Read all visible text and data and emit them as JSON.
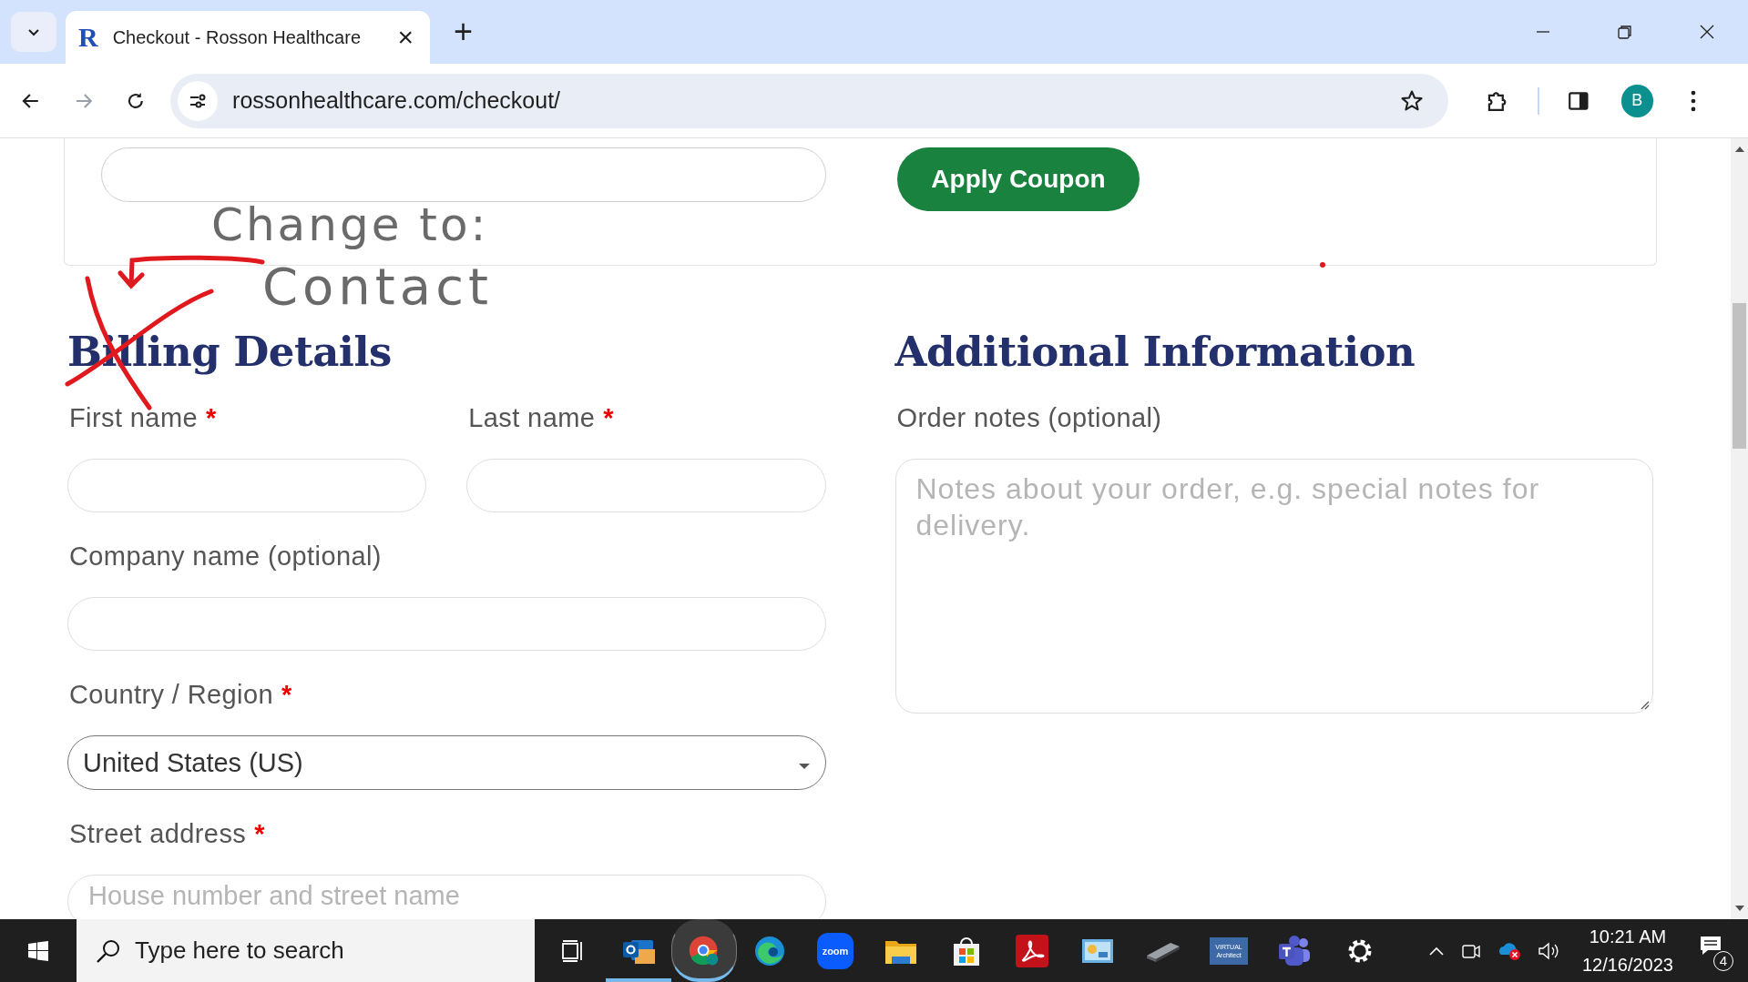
{
  "browser": {
    "favicon": "R",
    "tab_title": "Checkout - Rosson Healthcare",
    "close": "×",
    "new_tab": "+",
    "address": "rossonhealthcare.com/checkout/",
    "profile": "B"
  },
  "coupon": {
    "button": "Apply Coupon"
  },
  "annotation": {
    "lines": [
      "Change to:",
      "Contact"
    ]
  },
  "billing": {
    "heading": "Billing Details",
    "rows": [
      [
        {
          "label": "First name",
          "marker": "*",
          "kind": "input"
        },
        {
          "label": "Last name",
          "marker": "*",
          "kind": "input"
        }
      ],
      [
        {
          "label": "Company name (optional)",
          "kind": "input"
        }
      ],
      [
        {
          "label": "Country / Region",
          "marker": "*",
          "kind": "select",
          "value": "United States (US)"
        }
      ],
      [
        {
          "label": "Street address",
          "marker": "*",
          "kind": "input",
          "placeholder": "House number and street name"
        }
      ]
    ]
  },
  "additional": {
    "heading": "Additional Information",
    "label": "Order notes (optional)",
    "placeholder": "Notes about your order, e.g. special notes for delivery."
  },
  "taskbar": {
    "search_placeholder": "Type here to search",
    "apps": [
      {
        "kind": "task-view",
        "running": false,
        "selected": false
      },
      {
        "kind": "mail",
        "running": true,
        "selected": false
      },
      {
        "kind": "chrome",
        "running": true,
        "selected": true
      },
      {
        "kind": "edge",
        "running": false,
        "selected": false
      },
      {
        "kind": "zoom",
        "label": "zoom",
        "running": false,
        "selected": false
      },
      {
        "kind": "folder",
        "running": false,
        "selected": false
      },
      {
        "kind": "store",
        "running": false,
        "selected": false
      },
      {
        "kind": "pdf",
        "running": false,
        "selected": false
      },
      {
        "kind": "panel",
        "running": false,
        "selected": false
      },
      {
        "kind": "scanner",
        "running": false,
        "selected": false
      },
      {
        "kind": "architect",
        "label": "VIRTUAL Architect",
        "running": false,
        "selected": false
      },
      {
        "kind": "teams",
        "running": false,
        "selected": false
      },
      {
        "kind": "gear",
        "running": false,
        "selected": false
      }
    ],
    "time": "10:21 AM",
    "date": "12/16/2023",
    "notifications": "4"
  }
}
